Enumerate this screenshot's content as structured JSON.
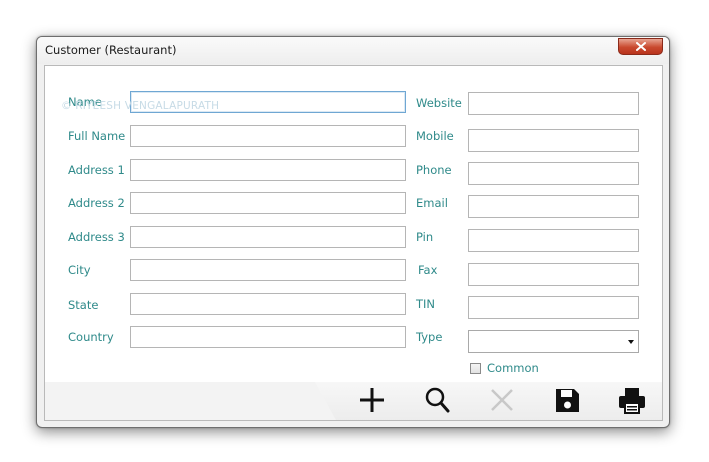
{
  "window": {
    "title": "Customer (Restaurant)"
  },
  "watermark": "© RIYEESH VENGALAPURATH",
  "left_fields": [
    {
      "label": "Name",
      "value": ""
    },
    {
      "label": "Full Name",
      "value": ""
    },
    {
      "label": "Address 1",
      "value": ""
    },
    {
      "label": "Address 2",
      "value": ""
    },
    {
      "label": "Address 3",
      "value": ""
    },
    {
      "label": "City",
      "value": ""
    },
    {
      "label": "State",
      "value": ""
    },
    {
      "label": "Country",
      "value": ""
    }
  ],
  "right_fields": [
    {
      "label": "Website",
      "value": ""
    },
    {
      "label": "Mobile",
      "value": ""
    },
    {
      "label": "Phone",
      "value": ""
    },
    {
      "label": "Email",
      "value": ""
    },
    {
      "label": "Pin",
      "value": ""
    },
    {
      "label": "Fax",
      "value": ""
    },
    {
      "label": "TIN",
      "value": ""
    }
  ],
  "type_field": {
    "label": "Type",
    "value": ""
  },
  "common_checkbox": {
    "label": "Common",
    "checked": false
  },
  "toolbar": {
    "add_icon": "plus-icon",
    "search_icon": "magnifier-icon",
    "delete_icon": "x-icon",
    "save_icon": "floppy-disk-icon",
    "print_icon": "printer-icon"
  },
  "colors": {
    "label_teal": "#2f8a8a",
    "close_red": "#c9492f",
    "disabled_gray": "#c8c8c8"
  }
}
